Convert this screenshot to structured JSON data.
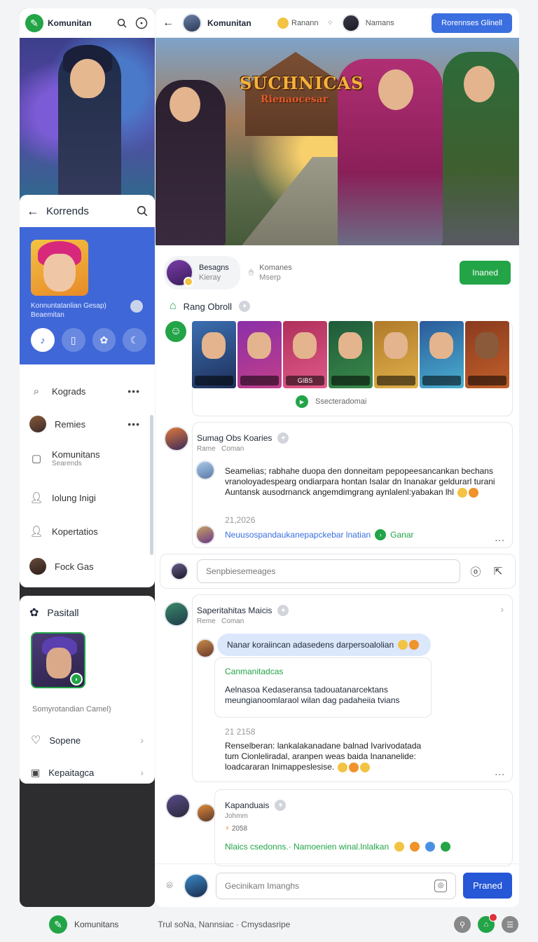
{
  "left": {
    "brand": "Komunitan",
    "panel": {
      "title": "Korrends",
      "caption_line1": "Konnuntatanlian Gesap)",
      "caption_line2": "Beaemitan"
    },
    "menu": [
      {
        "label": "Kograds",
        "icon": "search-icon"
      },
      {
        "label": "Remies",
        "icon": "avatar"
      },
      {
        "label": "Komunitans",
        "sub": "Searends",
        "icon": "square-icon"
      },
      {
        "label": "Iolung Inigi",
        "icon": "person-icon"
      },
      {
        "label": "Kopertatios",
        "icon": "person-icon"
      },
      {
        "label": "Fock Gas",
        "icon": "avatar"
      }
    ],
    "profile": {
      "title": "Pasitall",
      "caption": "Somyrotandian Camel)",
      "links": [
        {
          "label": "Sopene",
          "icon": "heart-icon"
        },
        {
          "label": "Kepaitagca",
          "icon": "image-icon"
        }
      ]
    }
  },
  "main": {
    "topbar": {
      "name": "Komunitan",
      "item1": "Ranann",
      "item2": "Namans",
      "cta": "Rorennses Glinell"
    },
    "banner": {
      "title": "SUCHNICAS",
      "subtitle": "Rienaocesar"
    },
    "post": {
      "author": "Besagns",
      "author_sub": "Kieray",
      "meta": "Komanes",
      "meta_sub": "Mserp",
      "follow": "Inaned"
    },
    "gallery": {
      "title": "Rang Obroll",
      "footer": "Ssecteradomai",
      "card_labels": [
        "",
        "",
        "GIBS",
        "",
        "",
        "",
        ""
      ]
    },
    "comment1": {
      "author": "Sumag Obs Koaries",
      "sub_left": "Rame",
      "sub_right": "Coman",
      "text": "Seamelias; rabhahe duopa den donneitam pepopeesancankan bechans vranoloyadespearg ondiarpara hontan Isalar dn Inanakar geldurarl turani Auntansk ausodrnanck angemdimgrang aynlalenl:yabakan lhl",
      "date": "21,2026",
      "link": "Neuusospandaukanepapckebar lnatian",
      "link_action": "Ganar"
    },
    "search1": {
      "placeholder": "Senpbiesemeages"
    },
    "comment2": {
      "author": "Saperitahitas Maicis",
      "sub_left": "Reme",
      "sub_right": "Coman",
      "bubble": "Nanar koraiincan adasedens darpersoalolian",
      "reply_title": "Canmanitadcas",
      "reply_text": "Aelnasoa Kedaseransa tadouatanarcektans meungianoomlaraol wilan dag padaheiia tvians",
      "date": "21 2158",
      "text": "Renselberan: lankalakanadane balnad Ivarivodatada tum Cionleliradal, aranpen weas baida Inananelide: loadcararan Inimappeslesise."
    },
    "comment3": {
      "author": "Kapanduais",
      "sub": "Johmm",
      "date": "2058",
      "link": "Nlaics csedonns.· Namoenien winal.lnlalkan"
    },
    "composer": {
      "placeholder": "Gecinikam Imanghs",
      "send": "Praned"
    }
  },
  "footer": {
    "brand": "Komunitans",
    "text": "Trul soNa, Nannsiac · Cmysdasripe"
  },
  "colors": {
    "accent_blue": "#3b6fe0",
    "accent_green": "#22a447",
    "panel_blue": "#3f67d8"
  }
}
